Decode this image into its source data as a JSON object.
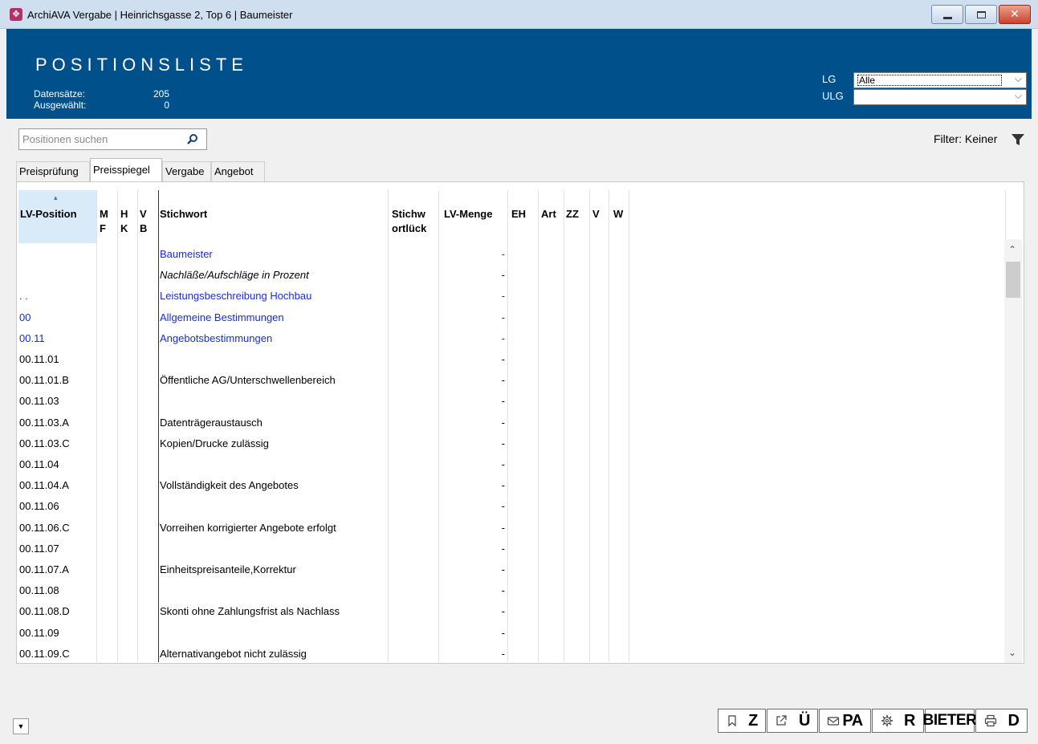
{
  "window": {
    "title": "ArchiAVA Vergabe | Heinrichsgasse 2, Top 6 | Baumeister",
    "icon": "app-logo-icon",
    "close_glyph": "✕"
  },
  "header": {
    "title": "POSITIONSLISTE",
    "stats": [
      {
        "label": "Datensätze:",
        "value": "205"
      },
      {
        "label": "Ausgewählt:",
        "value": "0"
      }
    ],
    "lg_label": "LG",
    "lg_value": "Alle",
    "ulg_label": "ULG",
    "ulg_value": ""
  },
  "search": {
    "placeholder": "Positionen suchen"
  },
  "filter": {
    "label": "Filter: Keiner"
  },
  "tabs": [
    {
      "label": "Preisprüfung",
      "active": false
    },
    {
      "label": "Preisspiegel",
      "active": true
    },
    {
      "label": "Vergabe",
      "active": false
    },
    {
      "label": "Angebot",
      "active": false
    }
  ],
  "columns": {
    "pos": "LV-Position",
    "mf1": "M",
    "mf2": "F",
    "hk1": "H",
    "hk2": "K",
    "vb1": "V",
    "vb2": "B",
    "stichwort": "Stichwort",
    "stichwortlueck1": "Stichw",
    "stichwortlueck2": "ortlück",
    "menge": "LV-Menge",
    "eh": "EH",
    "art": "Art",
    "zz": "ZZ",
    "v": "V",
    "w": "W"
  },
  "rows": [
    {
      "pos": "",
      "stichwort": "Baumeister",
      "menge": "-",
      "style": "blue"
    },
    {
      "pos": "",
      "stichwort": "Nachläße/Aufschläge in Prozent",
      "menge": "-",
      "style": "italic"
    },
    {
      "pos": ". .",
      "stichwort": "Leistungsbeschreibung Hochbau",
      "menge": "-",
      "style": "blue"
    },
    {
      "pos": "00",
      "stichwort": "Allgemeine Bestimmungen",
      "menge": "-",
      "style": "blue"
    },
    {
      "pos": "00.11",
      "stichwort": "Angebotsbestimmungen",
      "menge": "-",
      "style": "blue"
    },
    {
      "pos": "00.11.01",
      "stichwort": "",
      "menge": "-",
      "style": ""
    },
    {
      "pos": "00.11.01.B",
      "stichwort": "Öffentliche AG/Unterschwellenbereich",
      "menge": "-",
      "style": ""
    },
    {
      "pos": "00.11.03",
      "stichwort": "",
      "menge": "-",
      "style": ""
    },
    {
      "pos": "00.11.03.A",
      "stichwort": "Datenträgeraustausch",
      "menge": "-",
      "style": ""
    },
    {
      "pos": "00.11.03.C",
      "stichwort": "Kopien/Drucke zulässig",
      "menge": "-",
      "style": ""
    },
    {
      "pos": "00.11.04",
      "stichwort": "",
      "menge": "-",
      "style": ""
    },
    {
      "pos": "00.11.04.A",
      "stichwort": "Vollständigkeit des Angebotes",
      "menge": "-",
      "style": ""
    },
    {
      "pos": "00.11.06",
      "stichwort": "",
      "menge": "-",
      "style": ""
    },
    {
      "pos": "00.11.06.C",
      "stichwort": "Vorreihen korrigierter Angebote erfolgt",
      "menge": "-",
      "style": ""
    },
    {
      "pos": "00.11.07",
      "stichwort": "",
      "menge": "-",
      "style": ""
    },
    {
      "pos": "00.11.07.A",
      "stichwort": "Einheitspreisanteile,Korrektur",
      "menge": "-",
      "style": ""
    },
    {
      "pos": "00.11.08",
      "stichwort": "",
      "menge": "-",
      "style": ""
    },
    {
      "pos": "00.11.08.D",
      "stichwort": "Skonti ohne Zahlungsfrist als Nachlass",
      "menge": "-",
      "style": ""
    },
    {
      "pos": "00.11.09",
      "stichwort": "",
      "menge": "-",
      "style": ""
    },
    {
      "pos": "00.11.09.C",
      "stichwort": "Alternativangebot nicht zulässig",
      "menge": "-",
      "style": ""
    }
  ],
  "toolbar": [
    {
      "icon": "bookmark-icon",
      "label": "Z"
    },
    {
      "icon": "external-link-icon",
      "label": "Ü"
    },
    {
      "icon": "mail-icon",
      "label": "PA"
    },
    {
      "icon": "gear-icon",
      "label": "R"
    },
    {
      "icon": "",
      "label": "BIETER"
    },
    {
      "icon": "printer-icon",
      "label": "D"
    }
  ]
}
